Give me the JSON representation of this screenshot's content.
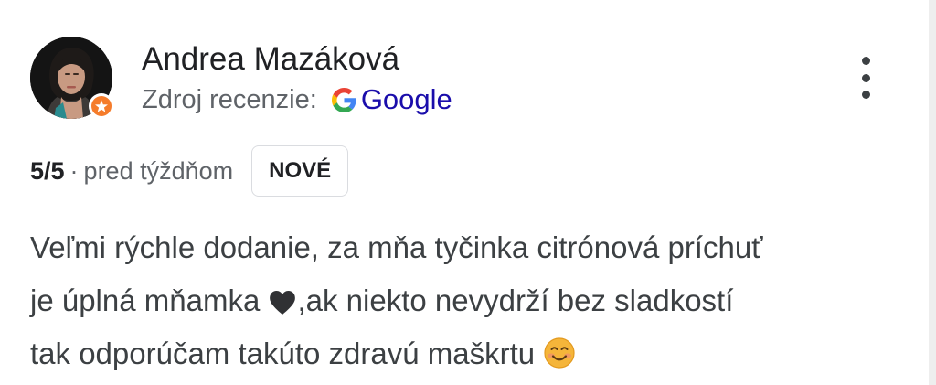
{
  "review": {
    "author": {
      "name": "Andrea Mazáková",
      "avatar_icon": "user-avatar-photo",
      "badge_icon": "local-guide-icon"
    },
    "source": {
      "label": "Zdroj recenzie:",
      "provider": "Google",
      "provider_icon": "google-g-icon"
    },
    "menu_icon": "more-vert-icon",
    "rating": "5/5",
    "separator": "·",
    "date": "pred týždňom",
    "badge": "NOVÉ",
    "text": {
      "line1": "Veľmi rýchle dodanie, za mňa tyčinka citrónová príchuť",
      "line2_before": "je úplná mňamka ",
      "heart_emoji_icon": "black-heart-icon",
      "line2_after": ",ak niekto nevydrží bez sladkostí",
      "line3": "tak odporúčam takúto zdravú maškrtu ",
      "smile_emoji_icon": "smiling-face-icon"
    }
  },
  "colors": {
    "text_primary": "#202124",
    "text_secondary": "#5f6368",
    "review_text": "#3c4043",
    "link_blue": "#1a0dab",
    "badge_orange": "#f57c2b",
    "badge_border": "#dadce0"
  }
}
